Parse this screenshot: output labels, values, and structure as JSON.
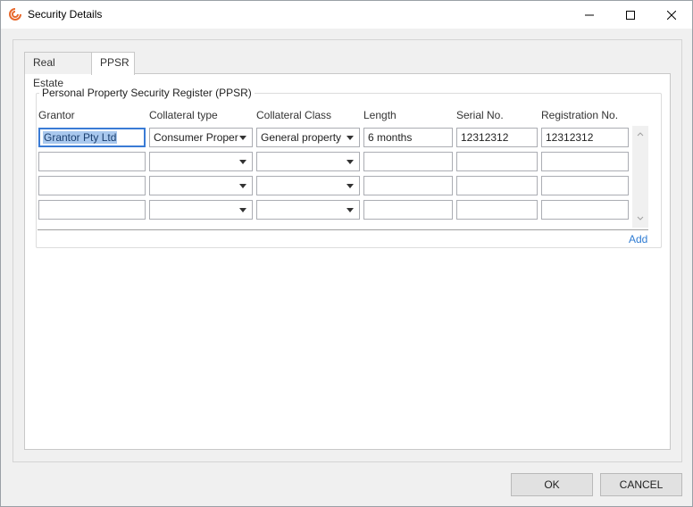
{
  "window": {
    "title": "Security Details",
    "icon": "swirl-logo-icon",
    "controls": [
      "minimize-icon",
      "maximize-icon",
      "close-icon"
    ]
  },
  "tabs": [
    {
      "label": "Real Estate",
      "active": false
    },
    {
      "label": "PPSR",
      "active": true
    }
  ],
  "ppsr": {
    "group_title": "Personal Property Security Register (PPSR)",
    "columns": [
      "Grantor",
      "Collateral type",
      "Collateral Class",
      "Length",
      "Serial No.",
      "Registration No."
    ],
    "rows": [
      {
        "grantor": "Grantor Pty Ltd",
        "collateral_type": "Consumer Proper",
        "collateral_class": "General property",
        "length": "6 months",
        "serial_no": "12312312",
        "registration_no": "12312312"
      },
      {
        "grantor": "",
        "collateral_type": "",
        "collateral_class": "",
        "length": "",
        "serial_no": "",
        "registration_no": ""
      },
      {
        "grantor": "",
        "collateral_type": "",
        "collateral_class": "",
        "length": "",
        "serial_no": "",
        "registration_no": ""
      },
      {
        "grantor": "",
        "collateral_type": "",
        "collateral_class": "",
        "length": "",
        "serial_no": "",
        "registration_no": ""
      }
    ],
    "add_label": "Add"
  },
  "footer": {
    "ok_label": "OK",
    "cancel_label": "CANCEL"
  },
  "colors": {
    "accent": "#2f7cd3",
    "selection": "#a9c8ee",
    "logo": "#e8692c"
  }
}
